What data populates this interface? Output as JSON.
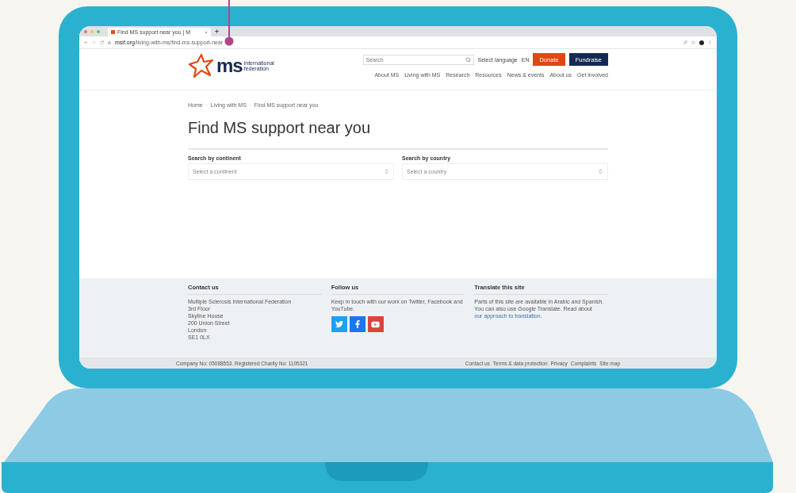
{
  "browser": {
    "tab_title": "Find MS support near you | M",
    "url_domain": "msif.org",
    "url_path": "/living-with-ms/find-ms-support-near"
  },
  "header": {
    "logo_word": "ms",
    "logo_tagline": [
      "international",
      "federation"
    ],
    "search": {
      "placeholder": "Search"
    },
    "language_label": "Select language",
    "language": "EN",
    "buttons": [
      {
        "label": "Donate",
        "kind": "primary"
      },
      {
        "label": "Fundraise",
        "kind": "secondary"
      }
    ],
    "nav": [
      "About MS",
      "Living with MS",
      "Research",
      "Resources",
      "News & events",
      "About us",
      "Get involved"
    ]
  },
  "breadcrumb": [
    "Home",
    "Living with MS",
    "Find MS support near you"
  ],
  "title": "Find MS support near you",
  "filters": [
    {
      "label": "Search by continent",
      "placeholder": "Select a continent"
    },
    {
      "label": "Search by country",
      "placeholder": "Select a country"
    }
  ],
  "footer": {
    "columns": [
      {
        "kind": "address",
        "heading": "Contact us",
        "lines": [
          "Multiple Sclerosis International Federation",
          "3rd Floor",
          "Skyline House",
          "200 Union Street",
          "London",
          "SE1 0LX"
        ]
      },
      {
        "kind": "social",
        "heading": "Follow us",
        "text": "Keep in touch with our work on Twitter, Facebook and YouTube."
      },
      {
        "kind": "translate",
        "heading": "Translate this site",
        "text": "Parts of this site are available in Arabic and Spanish. You can also use Google Translate. Read about",
        "link": "our approach to translation."
      }
    ]
  },
  "bottom_bar": {
    "company": "Company No: 05088553. Registered Charity No: 1105321",
    "links": [
      "Contact us",
      "Terms & data protection",
      "Privacy",
      "Complaints",
      "Site map"
    ]
  }
}
